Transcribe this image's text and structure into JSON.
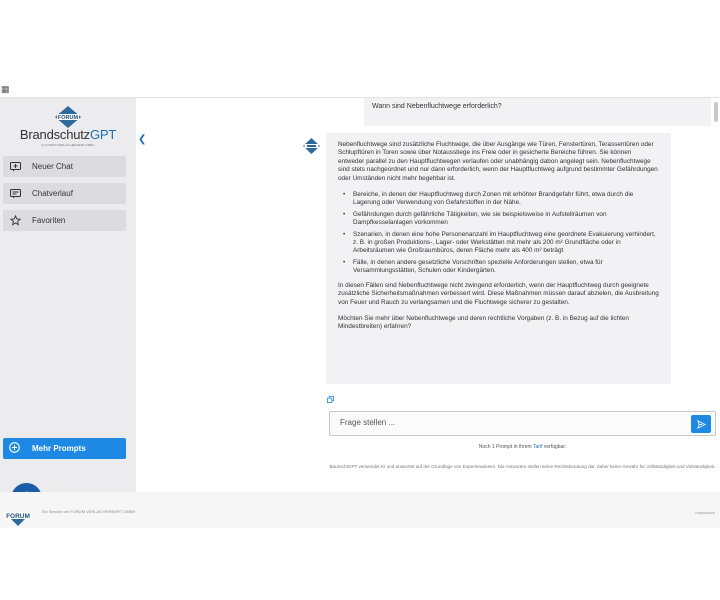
{
  "brand": {
    "logo_word": "FORUM",
    "name_part1": "Brandschutz",
    "name_part2": "GPT",
    "sub": "by FORUM VERLAG HERKERT GMBH"
  },
  "sidebar": {
    "items": [
      {
        "label": "Neuer Chat",
        "icon": "new-chat-icon"
      },
      {
        "label": "Chatverlauf",
        "icon": "chat-history-icon"
      },
      {
        "label": "Favoriten",
        "icon": "star-icon"
      }
    ],
    "more_prompts": "Mehr Prompts"
  },
  "chat": {
    "user_question": "Wann sind Nebenfluchtwege erforderlich?",
    "answer": {
      "intro": "Nebenfluchtwege sind zusätzliche Fluchtwege, die über Ausgänge wie Türen, Fenstertüren, Terassentüren oder Schlupftüren in Toren sowie über Notausstiege ins Freie oder in gesicherte Bereiche führen. Sie können entweder parallel zu den Hauptfluchtwegen verlaufen oder unabhängig dabon angelegt sein. Nebenfluchtwege sind stets nachgeordnet und nur dann erforderlich, wenn der Hauptfluchtweg aufgrund bestimmter Gefährdungen oder Umständen nicht mehr begehbar ist.",
      "bullets": [
        "Bereiche, in denen der Hauptfluchtweg durch Zonen mit erhöhter Brandgefahr führt, etwa durch die Lagerung oder Verwendung von Gefahrstoffen in der Nähe.",
        "Gefährdungen durch gefährliche Tätigkeiten, wie sie beispielsweise in Aufstellräumen von Dampfkesselanlagen vorkommen",
        "Szenarien, in denen eine hohe Personenanzahl im Hauptfluchtweg eine geordnete Evakuierung verhindert, z. B. in großen Produktions-, Lager- oder Werkstätten mit mehr als 200 m² Grundfläche oder in Arbeitsräumen wie Großraumbüros, deren Fläche mehr als 400 m² beträgt",
        "Fälle, in denen andere gesetzliche Vorschriften spezielle Anforderungen stellen, etwa für Versammlungsstätten, Schulen oder Kindergärten."
      ],
      "paragraph2": "In diesen Fällen sind Nebenfluchtwege nicht zwingend erforderlich, wenn der Hauptfluchtweg durch geeignete zusätzliche Sicherheitsmaßnahmen verbessert wird. Diese Maßnahmen müssen darauf abzielen, die Ausbreitung von Feuer und Rauch zu verlangsamen und die Fluchtwege sicherer zu gestalten.",
      "paragraph3": "Möchten Sie mehr über Nebenfluchtwege und deren rechtliche Vorgaben (z. B. in Bezug auf die lichten Mindestbreiten) erfahren?"
    }
  },
  "input": {
    "placeholder": "Frage stellen ..."
  },
  "quota": {
    "prefix": "Noch 1 Prompt in Ihrem",
    "tarif": "Tarif",
    "suffix": "verfügbar."
  },
  "disclaimer": "BaurechtGPT verwendet KI und antwortet auf der Grundlage von Expertenwissen. Die Antworten stellen keine Rechtsberatung dar, daher keine Gewähr für Vollständigkeit und Volständigkeit.",
  "footer": {
    "service": "Ein Service der FORUM VERLAG HERKERT GMBH",
    "impressum": "Impressum"
  },
  "colors": {
    "accent": "#1e88e5",
    "brand_blue": "#1e6fb3",
    "sidebar_bg": "#ececee"
  }
}
